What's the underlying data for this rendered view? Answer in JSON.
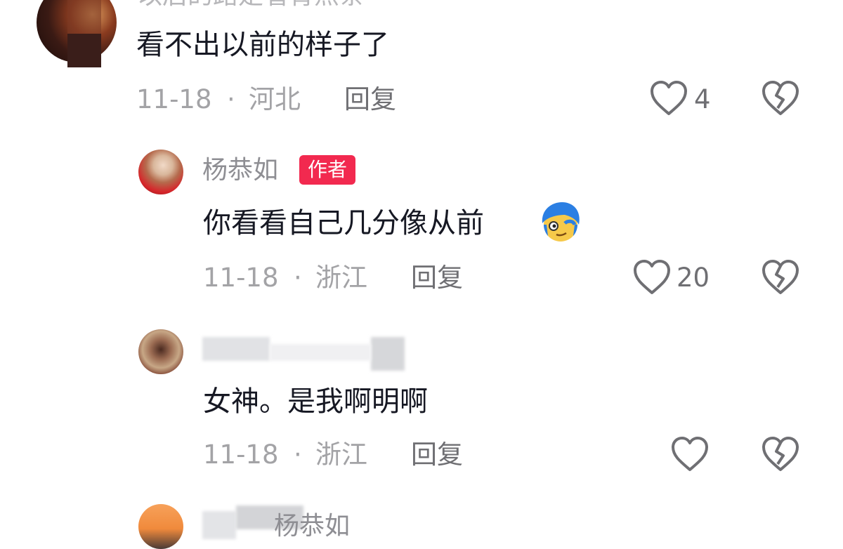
{
  "comments": [
    {
      "id": "c1",
      "username_partial": "以后的路是看青点条",
      "text": "看不出以前的样子了",
      "date": "11-18",
      "location": "河北",
      "reply_label": "回复",
      "likes": "4"
    },
    {
      "id": "c2",
      "username": "杨恭如",
      "author_badge": "作者",
      "text": "你看看自己几分像从前",
      "date": "11-18",
      "location": "浙江",
      "reply_label": "回复",
      "likes": "20"
    },
    {
      "id": "c3",
      "text": "女神。是我啊明啊",
      "date": "11-18",
      "location": "浙江",
      "reply_label": "回复",
      "likes": ""
    },
    {
      "id": "c4",
      "username": "杨恭如"
    }
  ],
  "separator": "·",
  "colors": {
    "badge": "#f2294f",
    "meta_text": "#a3a3a6",
    "body_text": "#161823",
    "icon_stroke": "#6f6f73"
  },
  "icons": {
    "like": "heart-outline-icon",
    "dislike": "broken-heart-icon"
  }
}
